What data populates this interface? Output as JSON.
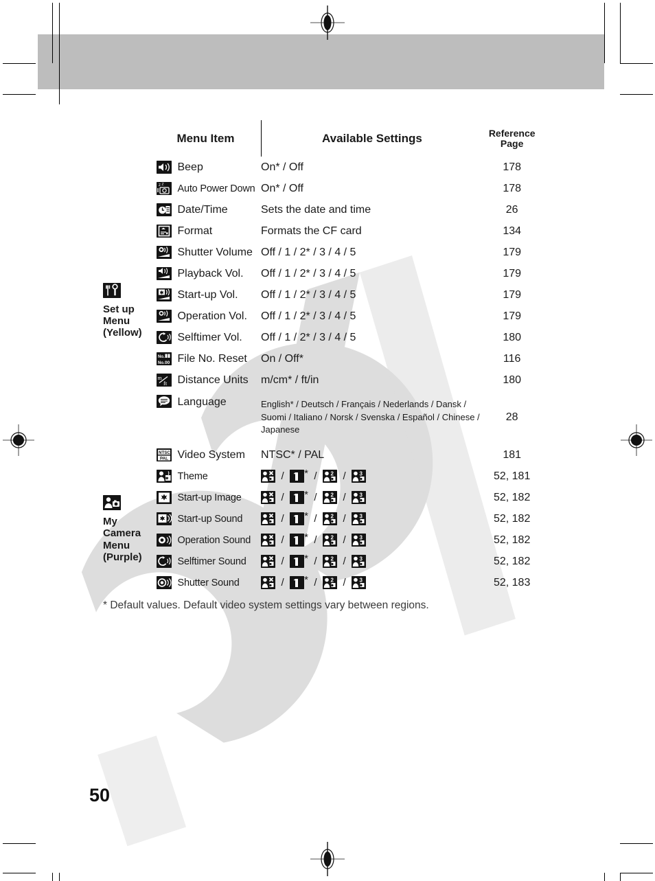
{
  "page": {
    "number": "50",
    "footnote": "*  Default values. Default video system settings vary between regions."
  },
  "table": {
    "headers": {
      "menu_item": "Menu Item",
      "available_settings": "Available Settings",
      "reference_page_line1": "Reference",
      "reference_page_line2": "Page"
    },
    "groups": [
      {
        "id": "set-up-menu",
        "icon": "tools-icon",
        "label_lines": [
          "Set up",
          "Menu",
          "(Yellow)"
        ],
        "rows": [
          {
            "icon": "speaker-icon",
            "label": "Beep",
            "settings": "On* / Off",
            "page": "178"
          },
          {
            "icon": "auto-power-down-icon",
            "label": "Auto Power Down",
            "settings": "On* / Off",
            "page": "178"
          },
          {
            "icon": "clock-icon",
            "label": "Date/Time",
            "settings": "Sets the date and time",
            "page": "26"
          },
          {
            "icon": "format-card-icon",
            "label": "Format",
            "settings": "Formats the CF card",
            "page": "134"
          },
          {
            "icon": "shutter-volume-icon",
            "label": "Shutter Volume",
            "settings": "Off / 1 / 2* / 3 / 4 / 5",
            "page": "179"
          },
          {
            "icon": "playback-volume-icon",
            "label": "Playback Vol.",
            "settings": "Off / 1 / 2* / 3 / 4 / 5",
            "page": "179"
          },
          {
            "icon": "startup-volume-icon",
            "label": "Start-up Vol.",
            "settings": "Off / 1 / 2* / 3 / 4 / 5",
            "page": "179"
          },
          {
            "icon": "operation-volume-icon",
            "label": "Operation Vol.",
            "settings": "Off / 1 / 2* / 3 / 4 / 5",
            "page": "179"
          },
          {
            "icon": "selftimer-volume-icon",
            "label": "Selftimer Vol.",
            "settings": "Off / 1 / 2* / 3 / 4 / 5",
            "page": "180"
          },
          {
            "icon": "file-number-icon",
            "label": "File No. Reset",
            "settings": "On / Off*",
            "page": "116"
          },
          {
            "icon": "distance-units-icon",
            "label": "Distance Units",
            "settings": "m/cm* /  ft/in",
            "page": "180"
          },
          {
            "icon": "language-icon",
            "label": "Language",
            "settings": "English* / Deutsch / Français / Nederlands / Dansk / Suomi / Italiano / Norsk / Svenska / Español / Chinese / Japanese",
            "page": "28",
            "multiline": true
          },
          {
            "icon": "video-system-icon",
            "label": "Video System",
            "settings": "NTSC* / PAL",
            "page": "181"
          }
        ]
      },
      {
        "id": "my-camera-menu",
        "icon": "my-camera-icon",
        "label_lines": [
          "My",
          "Camera",
          "Menu",
          "(Purple)"
        ],
        "rows": [
          {
            "icon": "theme-icon",
            "label": "Theme",
            "settings": "theme-set",
            "page": "52, 181"
          },
          {
            "icon": "startup-image-icon",
            "label": "Start-up Image",
            "settings": "theme-set",
            "page": "52, 182"
          },
          {
            "icon": "startup-sound-icon",
            "label": "Start-up Sound",
            "settings": "theme-set",
            "page": "52, 182"
          },
          {
            "icon": "operation-sound-icon",
            "label": "Operation Sound",
            "settings": "theme-set",
            "page": "52, 182"
          },
          {
            "icon": "selftimer-sound-icon",
            "label": "Selftimer Sound",
            "settings": "theme-set",
            "page": "52, 182"
          },
          {
            "icon": "shutter-sound-icon",
            "label": "Shutter Sound",
            "settings": "theme-set",
            "page": "52, 183"
          }
        ]
      }
    ],
    "theme_options": {
      "option_off": "person-x-icon",
      "option_1": "person-1-icon",
      "option_1_default_mark": "*",
      "option_2": "person-2-icon",
      "option_3": "person-3-icon",
      "separator": "/"
    }
  },
  "colors": {
    "header_band": "#bdbdbd",
    "rule": "#000000",
    "watermark": "#dcdcdc",
    "text": "#1a1a1a"
  }
}
